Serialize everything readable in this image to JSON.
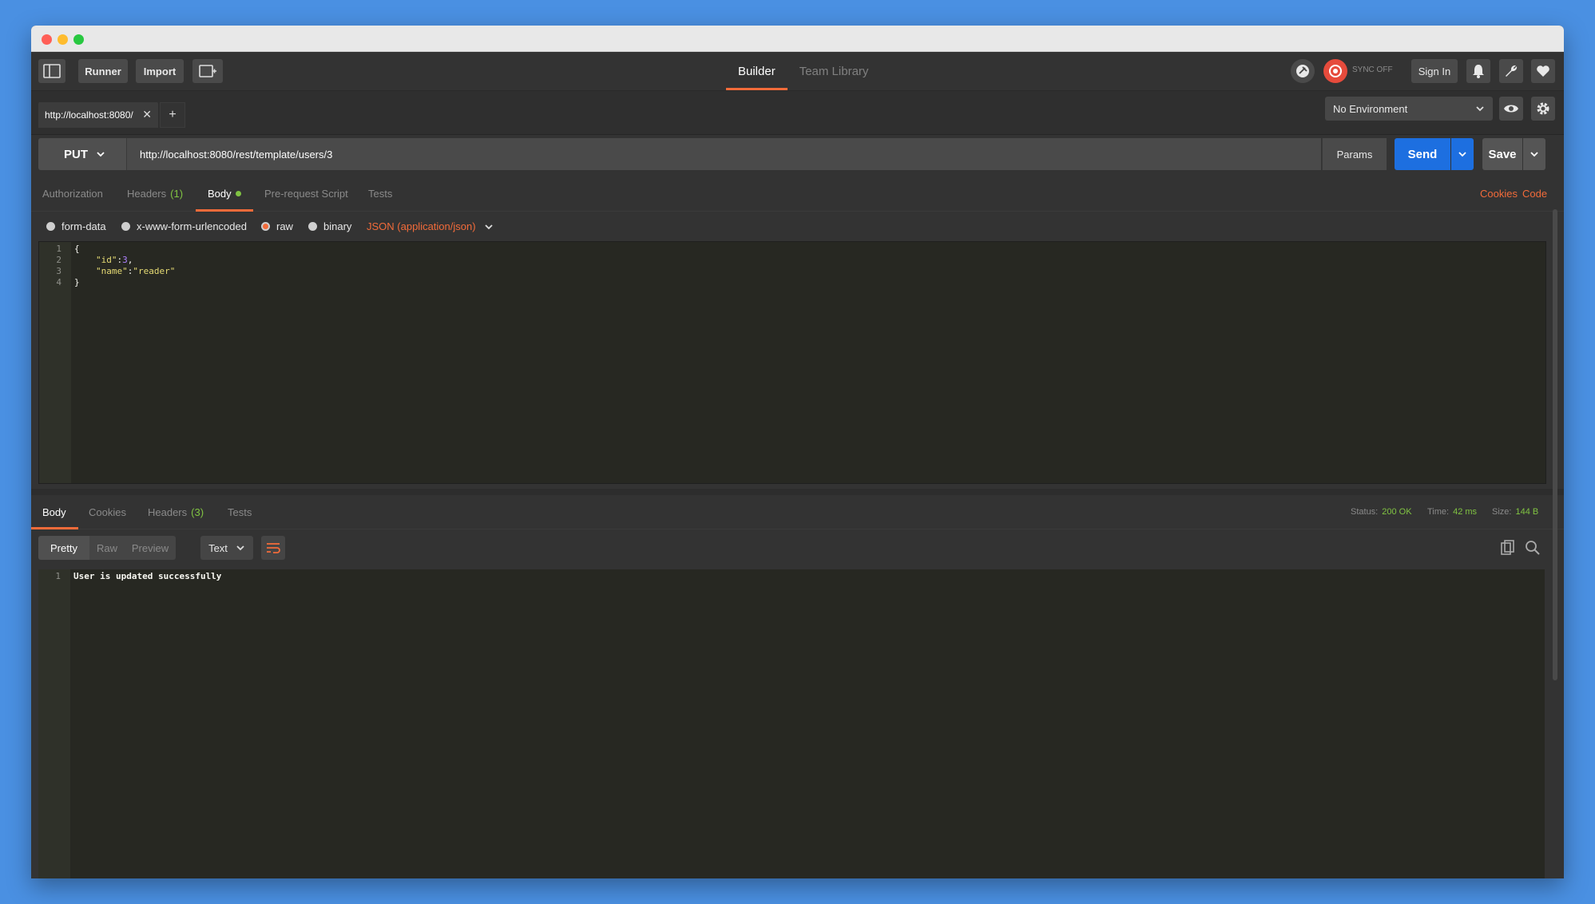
{
  "header": {
    "runner_label": "Runner",
    "import_label": "Import",
    "tabs": [
      {
        "label": "Builder"
      },
      {
        "label": "Team Library"
      }
    ],
    "sync_label": "SYNC OFF",
    "signin_label": "Sign In"
  },
  "request_tab": {
    "label": "http://localhost:8080/",
    "close_glyph": "✕",
    "add_glyph": "+"
  },
  "environment": {
    "selected": "No Environment"
  },
  "request": {
    "method": "PUT",
    "url": "http://localhost:8080/rest/template/users/3",
    "params_label": "Params",
    "send_label": "Send",
    "save_label": "Save"
  },
  "req_subtabs": {
    "authorization": "Authorization",
    "headers": "Headers",
    "headers_count": "(1)",
    "body": "Body",
    "prerequest": "Pre-request Script",
    "tests": "Tests",
    "cookies": "Cookies",
    "code": "Code"
  },
  "body_types": {
    "form_data": "form-data",
    "urlencoded": "x-www-form-urlencoded",
    "raw": "raw",
    "binary": "binary",
    "selected": "raw",
    "content_type": "JSON (application/json)"
  },
  "request_body": {
    "lines": [
      "1",
      "2",
      "3",
      "4"
    ],
    "l1": "{",
    "l2_key": "\"id\"",
    "l2_colon": ":",
    "l2_val": "3",
    "l2_comma": ",",
    "l3_key": "\"name\"",
    "l3_colon": ":",
    "l3_val": "\"reader\"",
    "l4": "}"
  },
  "response": {
    "tabs": {
      "body": "Body",
      "cookies": "Cookies",
      "headers": "Headers",
      "headers_count": "(3)",
      "tests": "Tests"
    },
    "status_label": "Status:",
    "status_value": "200 OK",
    "time_label": "Time:",
    "time_value": "42 ms",
    "size_label": "Size:",
    "size_value": "144 B",
    "view_modes": {
      "pretty": "Pretty",
      "raw": "Raw",
      "preview": "Preview"
    },
    "format": "Text",
    "line_number": "1",
    "body_text": "User is updated successfully"
  },
  "colors": {
    "accent": "#f26b3a",
    "send": "#1d6fe0",
    "success": "#80c342"
  }
}
